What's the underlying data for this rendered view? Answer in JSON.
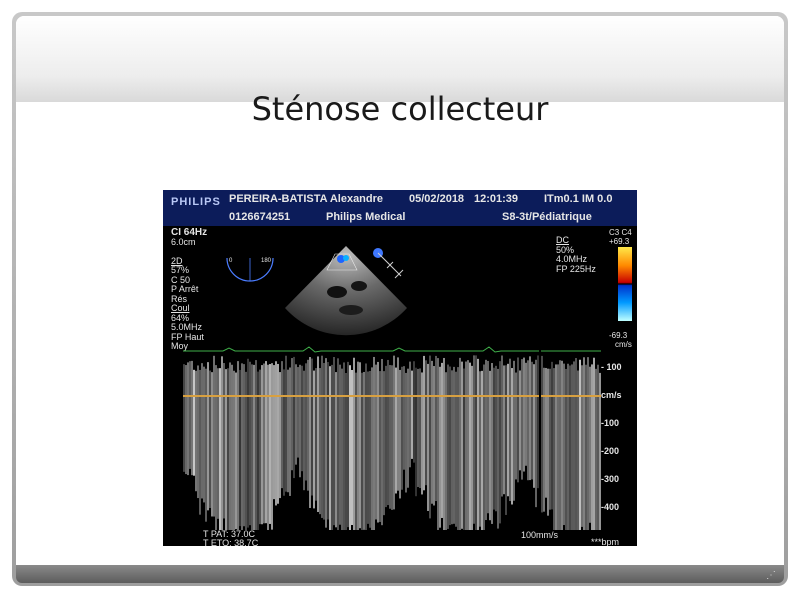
{
  "slide": {
    "title": "Sténose collecteur"
  },
  "ultrasound": {
    "header": {
      "logo": "PHILIPS",
      "patient": "PEREIRA-BATISTA Alexandre",
      "date": "05/02/2018",
      "time": "12:01:39",
      "indices": "ITm0.1  IM 0.0",
      "patient_id": "0126674251",
      "institution": "Philips Medical",
      "probe": "S8-3t/Pédiatrique"
    },
    "params_left": [
      "CI 64Hz",
      "6.0cm",
      "",
      "2D",
      "57%",
      "C 50",
      "P Arrêt",
      "Rés",
      "Coul",
      "64%",
      "5.0MHz",
      "FP Haut",
      "Moy"
    ],
    "mini_scale": {
      "min": "0",
      "max": "180"
    },
    "params_right": [
      "DC",
      "50%",
      "4.0MHz",
      "FP 225Hz"
    ],
    "color_scale": {
      "label": "C3 C4",
      "top": "+69.3",
      "bottom": "-69.3",
      "unit": "cm/s"
    },
    "doppler_scale": [
      {
        "label": "- 100",
        "value": 100
      },
      {
        "label": "cm/s",
        "value": 0
      },
      {
        "label": "-100",
        "value": -100
      },
      {
        "label": "-200",
        "value": -200
      },
      {
        "label": "-300",
        "value": -300
      },
      {
        "label": "-400",
        "value": -400
      }
    ],
    "footer": {
      "temp_pat": "T PAT: 37.0C",
      "temp_eto": "T ETO: 38.7C",
      "sweep": "100mm/s",
      "bpm": "***bpm"
    },
    "colors": {
      "header_bg": "#0c1c5a",
      "baseline": "#d8a040",
      "ecg": "#3fb04a"
    }
  }
}
